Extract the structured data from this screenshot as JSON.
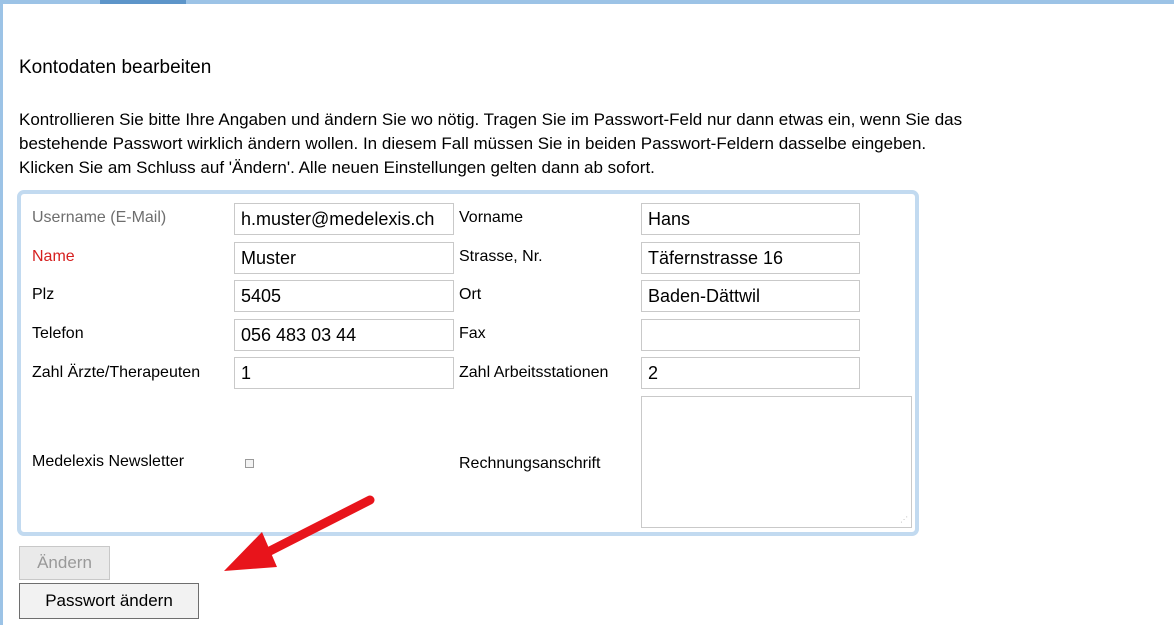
{
  "heading": "Kontodaten bearbeiten",
  "intro_lines": [
    "Kontrollieren Sie bitte Ihre Angaben und ändern Sie wo nötig. Tragen Sie im Passwort-Feld nur dann etwas ein, wenn Sie das",
    "bestehende Passwort wirklich ändern wollen. In diesem Fall müssen Sie in beiden Passwort-Feldern dasselbe eingeben.",
    "Klicken Sie am Schluss auf 'Ändern'. Alle neuen Einstellungen gelten dann ab sofort."
  ],
  "form": {
    "username_label": "Username (E-Mail)",
    "username_value": "h.muster@medelexis.ch",
    "vorname_label": "Vorname",
    "vorname_value": "Hans",
    "name_label": "Name",
    "name_value": "Muster",
    "strasse_label": "Strasse, Nr.",
    "strasse_value": "Täfernstrasse 16",
    "plz_label": "Plz",
    "plz_value": "5405",
    "ort_label": "Ort",
    "ort_value": "Baden-Dättwil",
    "telefon_label": "Telefon",
    "telefon_value": "056 483 03 44",
    "fax_label": "Fax",
    "fax_value": "",
    "aerzte_label": "Zahl Ärzte/Therapeuten",
    "aerzte_value": "1",
    "arbeitsstationen_label": "Zahl Arbeitsstationen",
    "arbeitsstationen_value": "2",
    "newsletter_label": "Medelexis Newsletter",
    "newsletter_checked": false,
    "rechnung_label": "Rechnungsanschrift",
    "rechnung_value": ""
  },
  "buttons": {
    "aendern": "Ändern",
    "passwort_aendern": "Passwort ändern"
  },
  "colors": {
    "frame": "#9cc3e6",
    "panel_border": "#c2daf0",
    "required_label": "#d62020",
    "arrow": "#e8141b"
  },
  "icons": {
    "arrow": "red-annotation-arrow-icon"
  }
}
